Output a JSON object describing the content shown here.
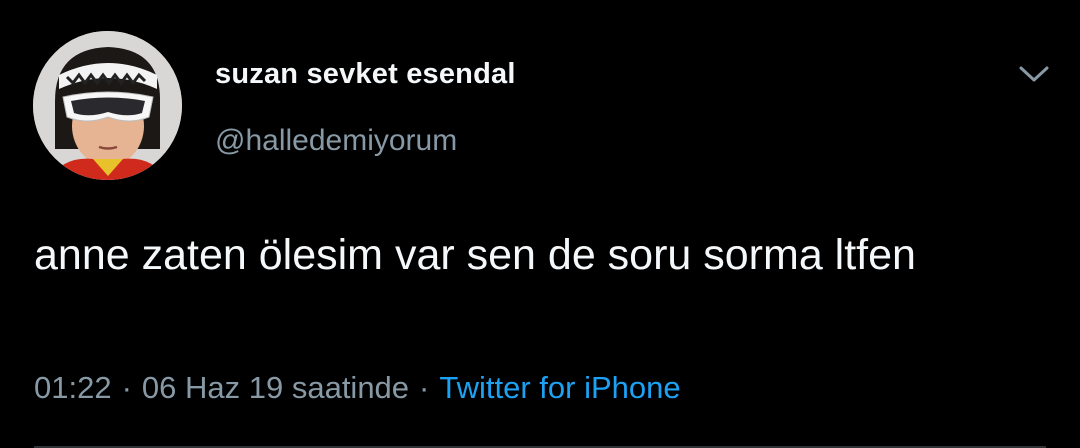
{
  "user": {
    "display_name": "suzan sevket esendal",
    "handle": "@halledemiyorum",
    "avatar_icon": "profile-photo"
  },
  "tweet": {
    "text": "anne zaten ölesim var sen de soru sorma ltfen",
    "time": "01:22",
    "separator": "·",
    "date": "06 Haz 19 saatinde",
    "source": "Twitter for iPhone"
  },
  "menu": {
    "icon": "chevron-down-icon"
  },
  "colors": {
    "background": "#000000",
    "primary_text": "#f5f8fa",
    "secondary_text": "#8899a6",
    "accent": "#1da1f2",
    "divider": "#2f3336"
  }
}
